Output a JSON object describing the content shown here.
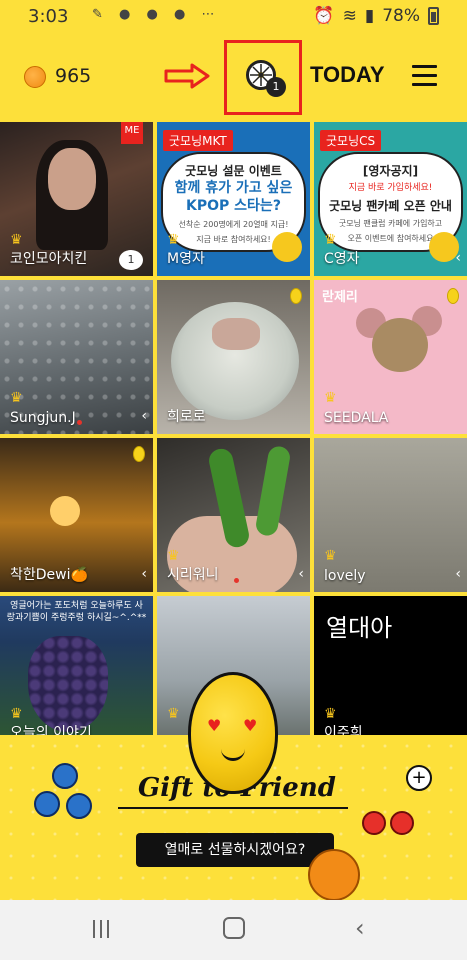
{
  "status_bar": {
    "time": "3:03",
    "battery_percent": "78%",
    "icons": [
      "edit-icon",
      "pills-icon",
      "lock-icon",
      "pills-icon",
      "more-icon",
      "alarm-icon",
      "hd-voice-icon",
      "wifi-icon",
      "signal-icon",
      "battery-icon"
    ]
  },
  "header": {
    "coin_count": "965",
    "wheel_badge": "1",
    "today_label": "TODAY",
    "accent_color": "#fde03a",
    "highlight_color": "#e8231e"
  },
  "tiles": [
    {
      "name": "코인모아치킨",
      "badge": "ME",
      "comment_count": "1"
    },
    {
      "tag": "굿모닝MKT",
      "line1": "굿모닝 설문 이벤트",
      "line2": "함께 휴가 가고 싶은",
      "line3": "KPOP 스타는?",
      "line4": "선착순 200명에게 20열매 지급!",
      "line5": "지금 바로 참여하세요!",
      "name": "M영자"
    },
    {
      "tag": "굿모닝CS",
      "line1": "[영자공지]",
      "line2": "지금 바로 가입하세요!",
      "line3": "굿모닝 팬카페 오픈 안내",
      "line4": "굿모닝 팬클럽 카페에 가입하고",
      "line5": "오픈 이벤트에 참여하세요",
      "name": "C영자"
    },
    {
      "name": "Sungjun.J"
    },
    {
      "name": "희로로"
    },
    {
      "label": "란제리",
      "name": "SEEDALA"
    },
    {
      "name": "착한Dewi🍊"
    },
    {
      "name": "시리워니"
    },
    {
      "name": "lovely"
    },
    {
      "caption": "영글어가는 포도처럼 오늘하루도 사랑과기쁨이 주렁주렁 하시길~^.^**",
      "name": "오늘의 이야기"
    },
    {
      "name": ""
    },
    {
      "big_text": "열대아",
      "name": "이주희"
    }
  ],
  "banner": {
    "title": "Gift to Friend",
    "button_label": "열매로 선물하시겠어요?"
  }
}
